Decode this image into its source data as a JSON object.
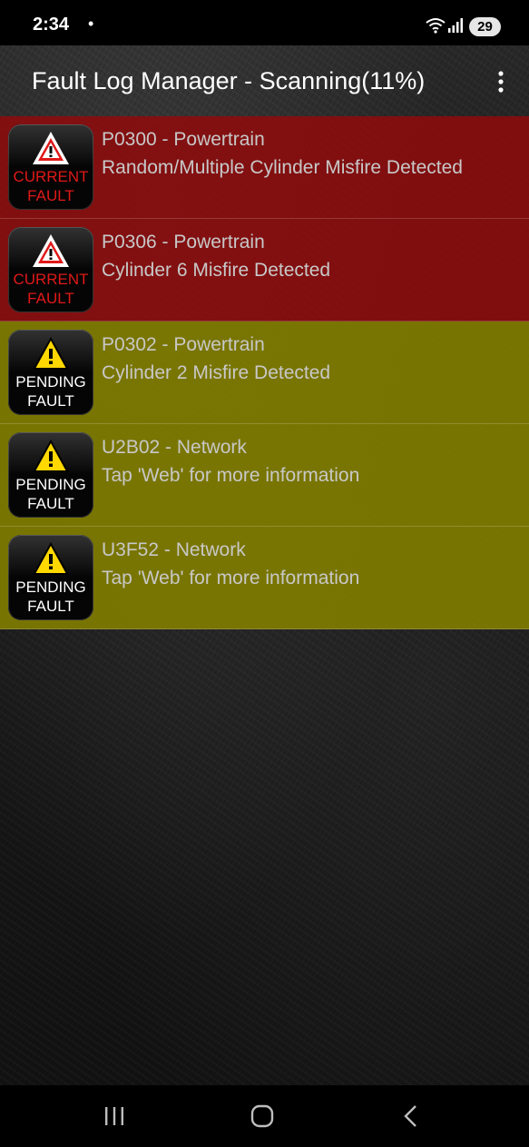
{
  "status_bar": {
    "time": "2:34",
    "notification_dot": "•",
    "battery": "29"
  },
  "app_bar": {
    "title": "Fault Log Manager - Scanning(11%)",
    "menu_icon": "more-vert-icon"
  },
  "faults": [
    {
      "status": "current",
      "badge_line1": "CURRENT",
      "badge_line2": "FAULT",
      "code": "P0300 - Powertrain",
      "description": "Random/Multiple Cylinder Misfire Detected"
    },
    {
      "status": "current",
      "badge_line1": "CURRENT",
      "badge_line2": "FAULT",
      "code": "P0306 - Powertrain",
      "description": "Cylinder 6 Misfire Detected"
    },
    {
      "status": "pending",
      "badge_line1": "PENDING",
      "badge_line2": "FAULT",
      "code": "P0302 - Powertrain",
      "description": "Cylinder 2 Misfire Detected"
    },
    {
      "status": "pending",
      "badge_line1": "PENDING",
      "badge_line2": "FAULT",
      "code": "U2B02 - Network",
      "description": "Tap 'Web' for more information"
    },
    {
      "status": "pending",
      "badge_line1": "PENDING",
      "badge_line2": "FAULT",
      "code": "U3F52 - Network",
      "description": "Tap 'Web' for more information"
    }
  ],
  "colors": {
    "current_row": "#910a0c",
    "pending_row": "#807c00",
    "current_badge_text": "#e01818",
    "pending_badge_text": "#ffffff",
    "warning_yellow": "#ffd800",
    "warning_white": "#ffffff",
    "warning_red": "#e01818"
  },
  "nav_bar": {
    "recents_icon": "recents-icon",
    "home_icon": "home-icon",
    "back_icon": "back-icon"
  }
}
